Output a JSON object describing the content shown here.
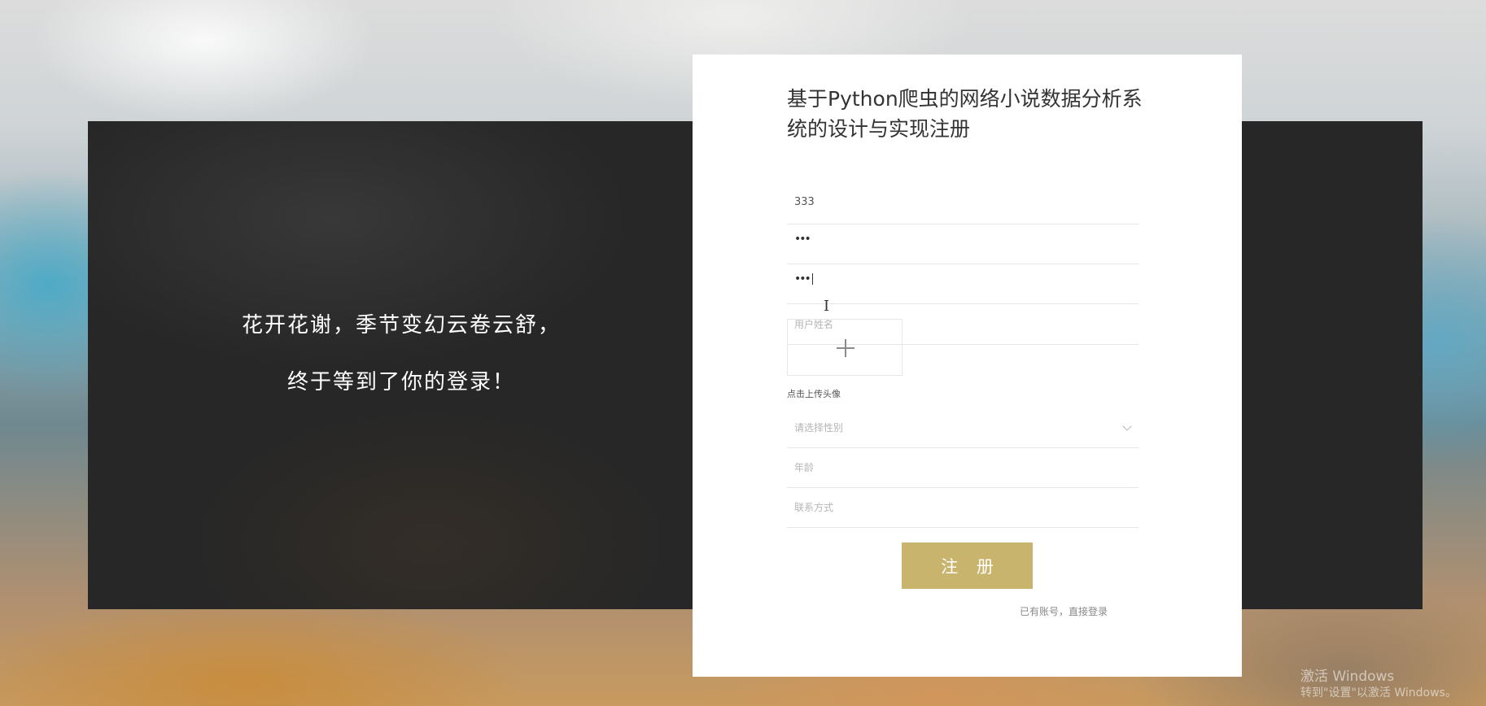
{
  "slogan": {
    "line1": "花开花谢，季节变幻云卷云舒，",
    "line2": "终于等到了你的登录！"
  },
  "form": {
    "title": "基于Python爬虫的网络小说数据分析系统的设计与实现注册",
    "username_value": "333",
    "password_dots": "•••",
    "confirm_dots": "•••",
    "realname_placeholder": "用户姓名",
    "upload_hint": "点击上传头像",
    "gender_placeholder": "请选择性别",
    "age_placeholder": "年龄",
    "contact_placeholder": "联系方式",
    "register_label": "注 册",
    "login_link": "已有账号，直接登录"
  },
  "watermark": {
    "line1": "激活 Windows",
    "line2": "转到\"设置\"以激活 Windows。"
  },
  "colors": {
    "button": "#c9b46e",
    "dark_panel": "#272727"
  }
}
